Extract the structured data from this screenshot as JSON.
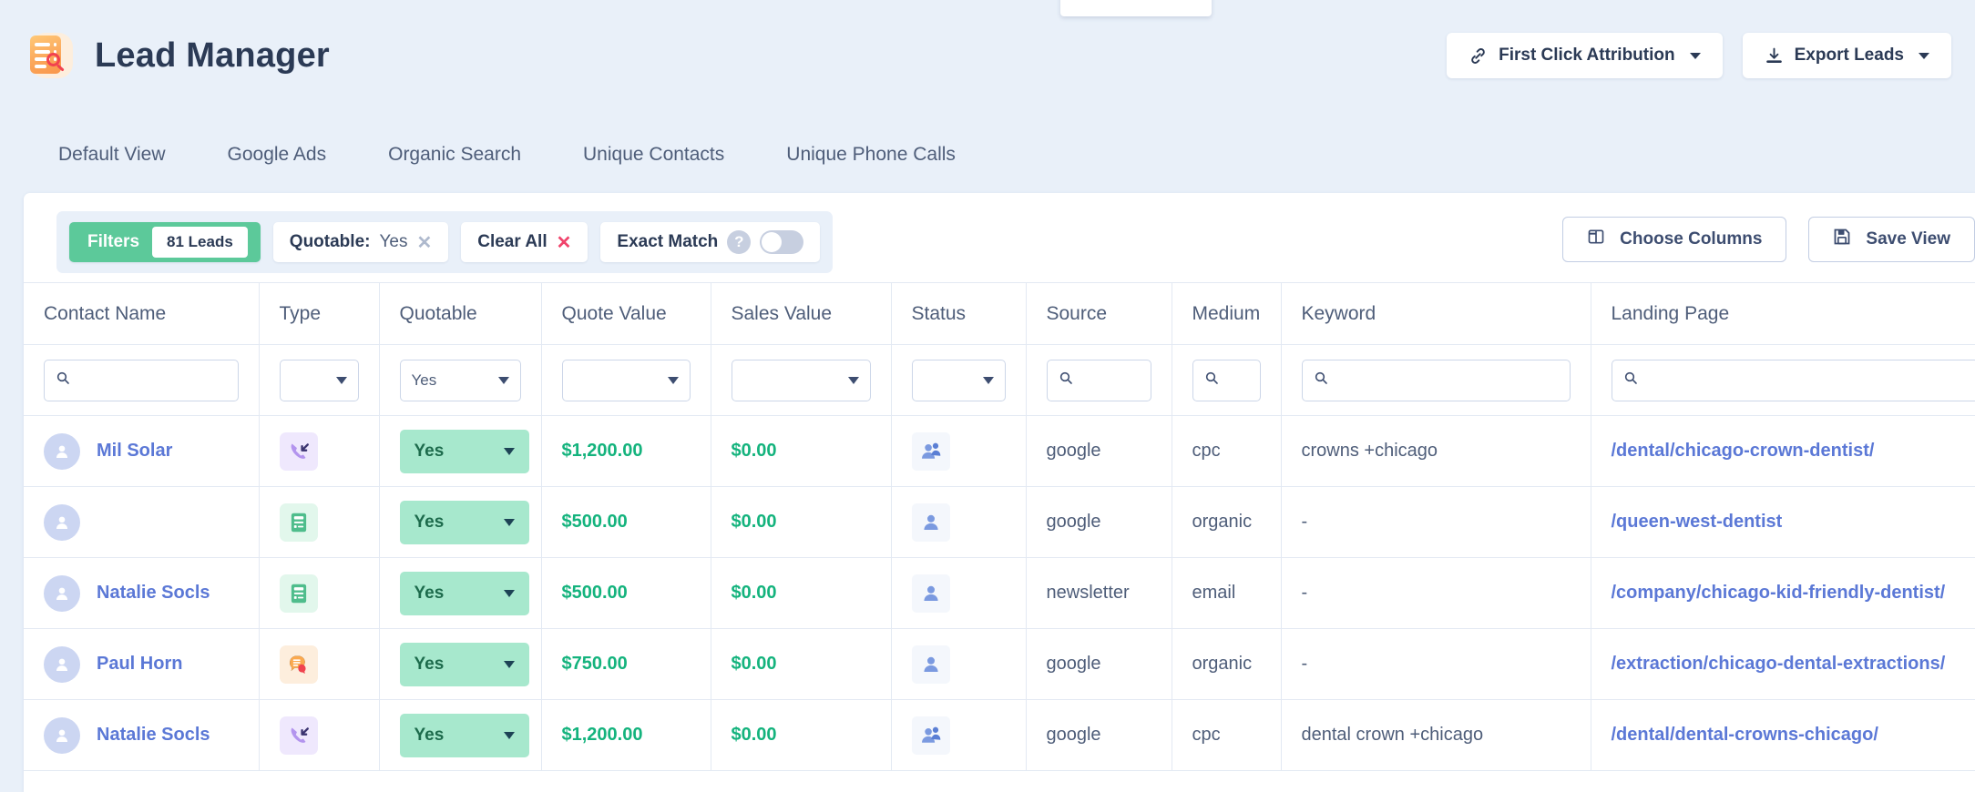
{
  "header": {
    "title": "Lead Manager",
    "logo_icon": "lead-document-search-icon",
    "actions": [
      {
        "label": "First Click Attribution",
        "icon": "link-icon",
        "has_caret": true
      },
      {
        "label": "Export Leads",
        "icon": "download-icon",
        "has_caret": true
      }
    ]
  },
  "tabs": [
    {
      "label": "Default View"
    },
    {
      "label": "Google Ads"
    },
    {
      "label": "Organic Search"
    },
    {
      "label": "Unique Contacts"
    },
    {
      "label": "Unique Phone Calls"
    }
  ],
  "toolbar": {
    "filters_label": "Filters",
    "leads_count": "81 Leads",
    "quotable_chip_label": "Quotable:",
    "quotable_chip_value": "Yes",
    "quotable_chip_remove": "✕",
    "clear_all_label": "Clear All",
    "clear_all_remove": "✕",
    "exact_match_label": "Exact Match",
    "exact_match_help": "?",
    "exact_match_on": false,
    "choose_columns_label": "Choose Columns",
    "save_view_label": "Save View"
  },
  "table": {
    "columns": [
      {
        "key": "contact_name",
        "label": "Contact Name",
        "filter": "search",
        "filter_value": ""
      },
      {
        "key": "type",
        "label": "Type",
        "filter": "select",
        "filter_value": ""
      },
      {
        "key": "quotable",
        "label": "Quotable",
        "filter": "select",
        "filter_value": "Yes"
      },
      {
        "key": "quote_value",
        "label": "Quote Value",
        "filter": "select",
        "filter_value": ""
      },
      {
        "key": "sales_value",
        "label": "Sales Value",
        "filter": "select",
        "filter_value": ""
      },
      {
        "key": "status",
        "label": "Status",
        "filter": "select",
        "filter_value": ""
      },
      {
        "key": "source",
        "label": "Source",
        "filter": "search",
        "filter_value": ""
      },
      {
        "key": "medium",
        "label": "Medium",
        "filter": "search",
        "filter_value": ""
      },
      {
        "key": "keyword",
        "label": "Keyword",
        "filter": "search",
        "filter_value": ""
      },
      {
        "key": "landing_page",
        "label": "Landing Page",
        "filter": "search",
        "filter_value": ""
      }
    ],
    "rows": [
      {
        "contact_name": "Mil Solar",
        "type_icon": "phone-incoming-icon",
        "quotable": "Yes",
        "quote_value": "$1,200.00",
        "sales_value": "$0.00",
        "status_icon": "returning-users-icon",
        "source": "google",
        "medium": "cpc",
        "keyword": "crowns +chicago",
        "landing_page": "/dental/chicago-crown-dentist/"
      },
      {
        "contact_name": "",
        "type_icon": "form-submission-icon",
        "quotable": "Yes",
        "quote_value": "$500.00",
        "sales_value": "$0.00",
        "status_icon": "new-user-icon",
        "source": "google",
        "medium": "organic",
        "keyword": "-",
        "landing_page": "/queen-west-dentist"
      },
      {
        "contact_name": "Natalie Socls",
        "type_icon": "form-submission-icon",
        "quotable": "Yes",
        "quote_value": "$500.00",
        "sales_value": "$0.00",
        "status_icon": "new-user-icon",
        "source": "newsletter",
        "medium": "email",
        "keyword": "-",
        "landing_page": "/company/chicago-kid-friendly-dentist/"
      },
      {
        "contact_name": "Paul Horn",
        "type_icon": "chat-message-icon",
        "quotable": "Yes",
        "quote_value": "$750.00",
        "sales_value": "$0.00",
        "status_icon": "new-user-icon",
        "source": "google",
        "medium": "organic",
        "keyword": "-",
        "landing_page": "/extraction/chicago-dental-extractions/"
      },
      {
        "contact_name": "Natalie Socls",
        "type_icon": "phone-incoming-icon",
        "quotable": "Yes",
        "quote_value": "$1,200.00",
        "sales_value": "$0.00",
        "status_icon": "returning-users-icon",
        "source": "google",
        "medium": "cpc",
        "keyword": "dental crown +chicago",
        "landing_page": "/dental/dental-crowns-chicago/"
      }
    ]
  },
  "colors": {
    "page_bg": "#e9f0f9",
    "accent_green": "#5cc99a",
    "pill_green": "#a7e8cd",
    "money_green": "#14b37d",
    "link_blue": "#5b78d6",
    "text_dark": "#2b3a55"
  }
}
